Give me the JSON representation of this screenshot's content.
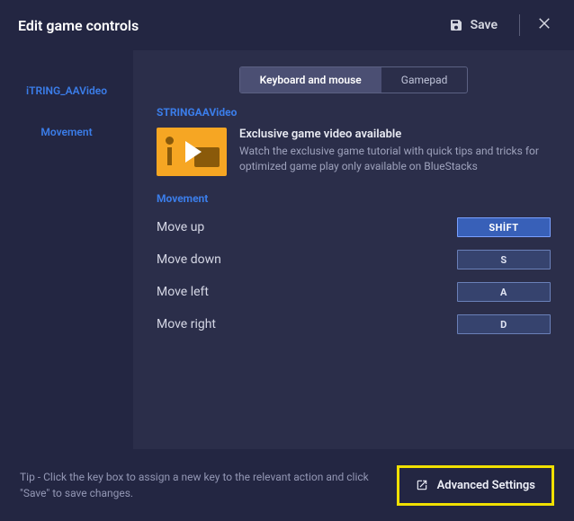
{
  "header": {
    "title": "Edit game controls",
    "save_label": "Save"
  },
  "sidebar": {
    "items": [
      {
        "label": "iTRING_AAVideo"
      },
      {
        "label": "Movement"
      }
    ]
  },
  "tabs": [
    {
      "label": "Keyboard and mouse",
      "active": true
    },
    {
      "label": "Gamepad",
      "active": false
    }
  ],
  "video": {
    "section_title": "STRINGAAVideo",
    "title": "Exclusive game video available",
    "description": "Watch the exclusive game tutorial with quick tips and tricks for optimized game play only available on BlueStacks"
  },
  "movement": {
    "section_title": "Movement",
    "bindings": [
      {
        "label": "Move up",
        "key": "SHİFT",
        "active": true
      },
      {
        "label": "Move down",
        "key": "S",
        "active": false
      },
      {
        "label": "Move left",
        "key": "A",
        "active": false
      },
      {
        "label": "Move right",
        "key": "D",
        "active": false
      }
    ]
  },
  "footer": {
    "tip": "Tip - Click the key box to assign a new key to the relevant action and click \"Save\" to save changes.",
    "advanced_label": "Advanced Settings"
  }
}
